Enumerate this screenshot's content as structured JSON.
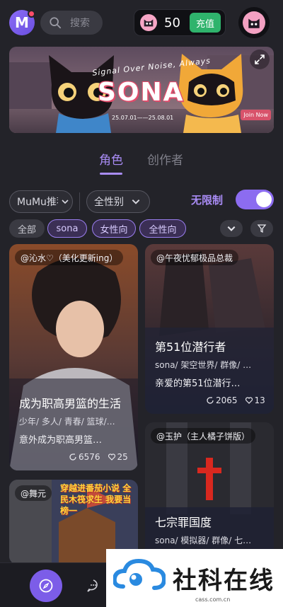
{
  "header": {
    "logo_letter": "M",
    "search_placeholder": "搜索",
    "coin_count": "50",
    "recharge_label": "充值"
  },
  "banner": {
    "tagline": "Signal Over Noise, Always",
    "title": "SONA",
    "date_range": "25.07.01——25.08.01",
    "join_label": "Join Now"
  },
  "tabs": [
    {
      "label": "角色",
      "active": true
    },
    {
      "label": "创作者",
      "active": false
    }
  ],
  "filters": {
    "source_dropdown": "MuMu推荐",
    "gender_dropdown": "全性别",
    "no_limit_label": "无限制",
    "no_limit_on": true,
    "chips": [
      "全部",
      "sona",
      "女性向",
      "全性向"
    ]
  },
  "cards": [
    {
      "author": "@沁水♡（美化更新ing）",
      "name": "成为职高男篮的生活",
      "tags": "少年/ 多人/ 青春/ 篮球/…",
      "desc": "意外成为职高男篮…",
      "likes": "6576",
      "hearts": "25"
    },
    {
      "author": "@午夜忧郁极品总裁",
      "name": "第51位潜行者",
      "tags": "sona/ 架空世界/ 群像/ …",
      "desc": "亲爱的第51位潜行…",
      "likes": "2065",
      "hearts": "13"
    },
    {
      "author": "@舞元",
      "name": "",
      "art_text": "穿越进番茄小说 全民木筏求生 我要当榜一",
      "tags": "",
      "desc": ""
    },
    {
      "author": "@玉护（主人橘子饼版）",
      "name": "七宗罪国度",
      "tags": "sona/ 模拟器/ 群像/ 七…",
      "desc": ""
    }
  ],
  "watermark": {
    "text": "社科在线",
    "url": "cass.com.cn"
  },
  "colors": {
    "accent": "#a98cf5",
    "toggle": "#8c6cf0",
    "recharge": "#2fb36c",
    "background": "#232329"
  }
}
